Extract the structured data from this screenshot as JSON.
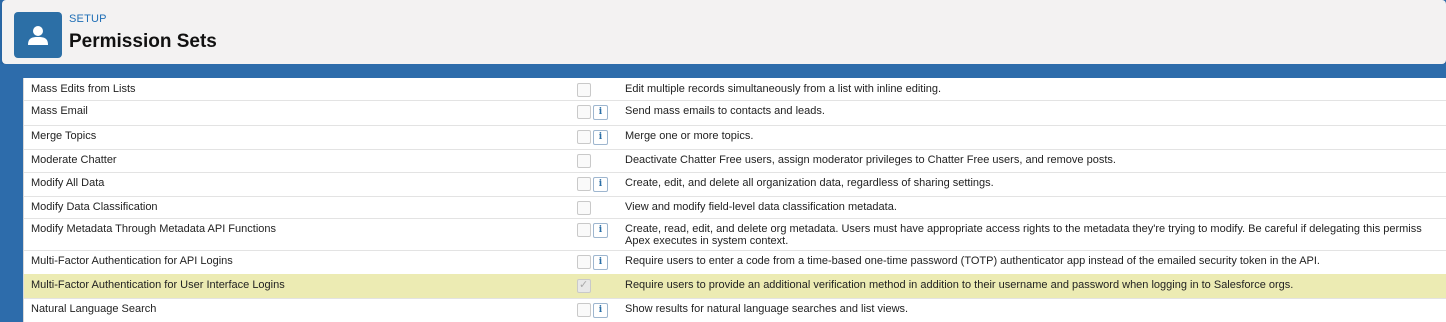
{
  "header": {
    "section": "SETUP",
    "title": "Permission Sets",
    "icon": "user-icon"
  },
  "rows": [
    {
      "name": "Mass Edits from Lists",
      "checked": false,
      "has_info": false,
      "desc": "Edit multiple records simultaneously from a list with inline editing."
    },
    {
      "name": "Mass Email",
      "checked": false,
      "has_info": true,
      "desc": "Send mass emails to contacts and leads."
    },
    {
      "name": "Merge Topics",
      "checked": false,
      "has_info": true,
      "desc": "Merge one or more topics."
    },
    {
      "name": "Moderate Chatter",
      "checked": false,
      "has_info": false,
      "desc": "Deactivate Chatter Free users, assign moderator privileges to Chatter Free users, and remove posts."
    },
    {
      "name": "Modify All Data",
      "checked": false,
      "has_info": true,
      "desc": "Create, edit, and delete all organization data, regardless of sharing settings."
    },
    {
      "name": "Modify Data Classification",
      "checked": false,
      "has_info": false,
      "desc": "View and modify field-level data classification metadata."
    },
    {
      "name": "Modify Metadata Through Metadata API Functions",
      "checked": false,
      "has_info": true,
      "desc": "Create, read, edit, and delete org metadata. Users must have appropriate access rights to the metadata they're trying to modify. Be careful if delegating this permiss Apex executes in system context."
    },
    {
      "name": "Multi-Factor Authentication for API Logins",
      "checked": false,
      "has_info": true,
      "desc": "Require users to enter a code from a time-based one-time password (TOTP) authenticator app instead of the emailed security token in the API."
    },
    {
      "name": "Multi-Factor Authentication for User Interface Logins",
      "checked": true,
      "has_info": false,
      "highlighted": true,
      "desc": "Require users to provide an additional verification method in addition to their username and password when logging in to Salesforce orgs."
    },
    {
      "name": "Natural Language Search",
      "checked": false,
      "has_info": true,
      "desc": "Show results for natural language searches and list views."
    }
  ],
  "info_glyph": "i"
}
